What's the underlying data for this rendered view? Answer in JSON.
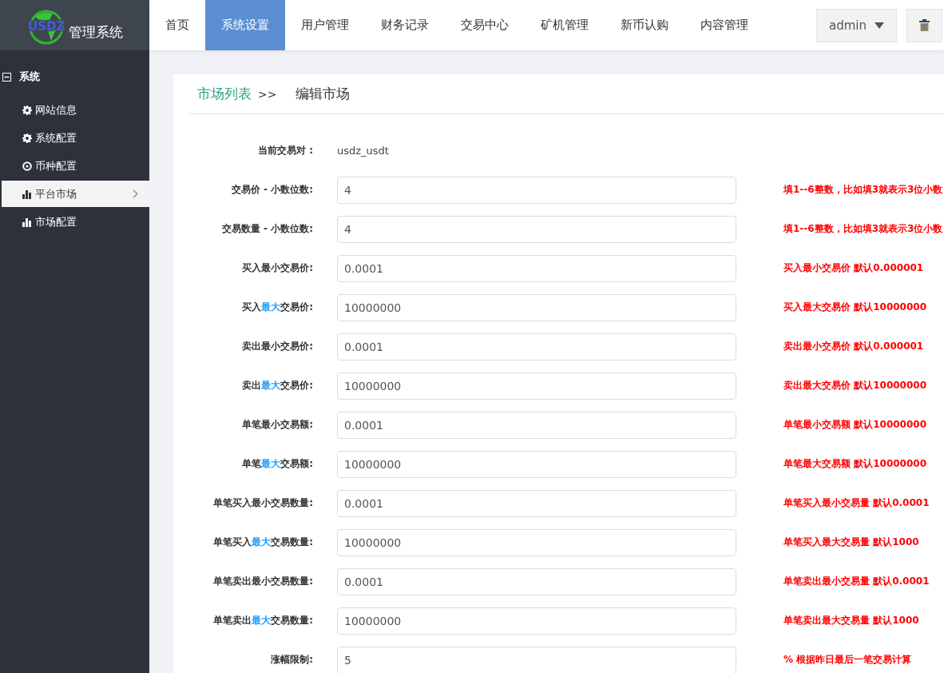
{
  "brand": {
    "logo": "USDZ",
    "title": "管理系统"
  },
  "nav": [
    {
      "label": "首页",
      "selected": false
    },
    {
      "label": "系统设置",
      "selected": true
    },
    {
      "label": "用户管理",
      "selected": false
    },
    {
      "label": "财务记录",
      "selected": false
    },
    {
      "label": "交易中心",
      "selected": false
    },
    {
      "label": "矿机管理",
      "selected": false
    },
    {
      "label": "新币认购",
      "selected": false
    },
    {
      "label": "内容管理",
      "selected": false
    }
  ],
  "user_menu": {
    "label": "admin"
  },
  "sidebar": {
    "group": {
      "label": "系统",
      "expanded": true
    },
    "items": [
      {
        "label": "网站信息",
        "kind": "gear",
        "selected": false
      },
      {
        "label": "系统配置",
        "kind": "gear",
        "selected": false
      },
      {
        "label": "币种配置",
        "kind": "target",
        "selected": false
      },
      {
        "label": "平台市场",
        "kind": "chart",
        "selected": true
      },
      {
        "label": "市场配置",
        "kind": "chart",
        "selected": false
      }
    ]
  },
  "breadcrumb": {
    "link": "市场列表",
    "separator": ">>",
    "current": "编辑市场"
  },
  "pair": {
    "label": "当前交易对 :",
    "value": "usdz_usdt"
  },
  "fields": [
    {
      "label": "交易价 - 小数位数:",
      "value": "4",
      "hint": "填1--6整数，比如填3就表示3位小数"
    },
    {
      "label": "交易数量 - 小数位数:",
      "value": "4",
      "hint": "填1--6整数，比如填3就表示3位小数"
    },
    {
      "label": "买入最小交易价:",
      "value": "0.0001",
      "hint": "买入最小交易价 默认0.000001"
    },
    {
      "label": "买入**最大**交易价:",
      "value": "10000000",
      "hint": "买入最大交易价 默认10000000"
    },
    {
      "label": "卖出最小交易价:",
      "value": "0.0001",
      "hint": "卖出最小交易价 默认0.000001"
    },
    {
      "label": "卖出**最大**交易价:",
      "value": "10000000",
      "hint": "卖出最大交易价 默认10000000"
    },
    {
      "label": "单笔最小交易额:",
      "value": "0.0001",
      "hint": "单笔最小交易额 默认10000000"
    },
    {
      "label": "单笔**最大**交易额:",
      "value": "10000000",
      "hint": "单笔最大交易额 默认10000000"
    },
    {
      "label": "单笔买入最小交易数量:",
      "value": "0.0001",
      "hint": "单笔买入最小交易量 默认0.0001"
    },
    {
      "label": "单笔买入**最大**交易数量:",
      "value": "10000000",
      "hint": "单笔买入最大交易量 默认1000"
    },
    {
      "label": "单笔卖出最小交易数量:",
      "value": "0.0001",
      "hint": "单笔卖出最小交易量 默认0.0001"
    },
    {
      "label": "单笔卖出**最大**交易数量:",
      "value": "10000000",
      "hint": "单笔卖出最大交易量 默认1000"
    },
    {
      "label": "涨幅限制:",
      "value": "5",
      "hint": "% 根据昨日最后一笔交易计算"
    }
  ]
}
